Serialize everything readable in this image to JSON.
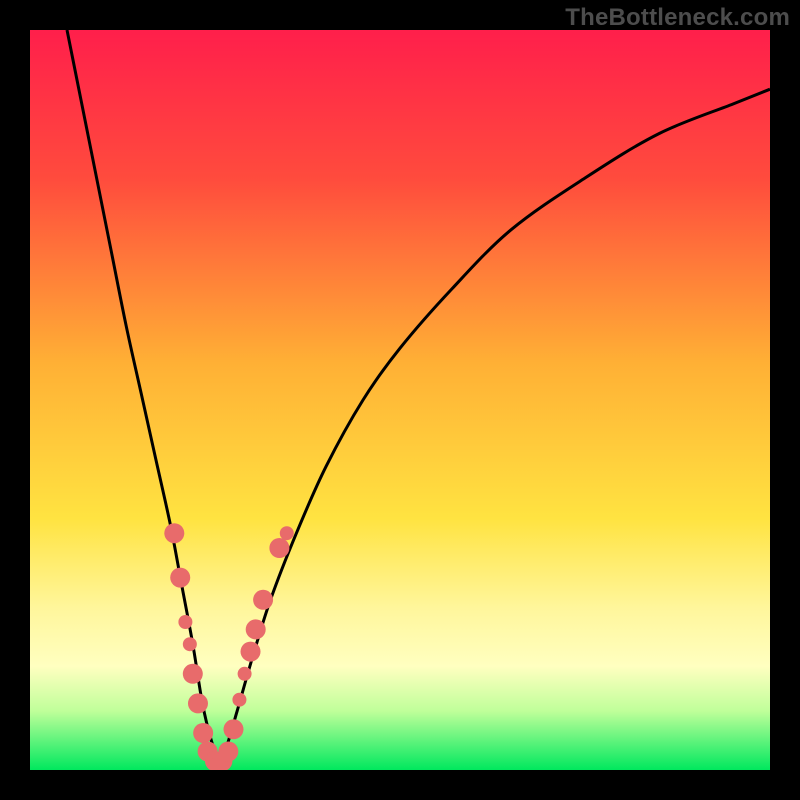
{
  "watermark": {
    "text": "TheBottleneck.com"
  },
  "gradient": {
    "stops": [
      {
        "pct": 0,
        "color": "#ff1f4b"
      },
      {
        "pct": 20,
        "color": "#ff4b3d"
      },
      {
        "pct": 45,
        "color": "#ffb035"
      },
      {
        "pct": 66,
        "color": "#ffe341"
      },
      {
        "pct": 78,
        "color": "#fff69b"
      },
      {
        "pct": 86,
        "color": "#ffffc0"
      },
      {
        "pct": 92,
        "color": "#c0ff9a"
      },
      {
        "pct": 100,
        "color": "#00e85e"
      }
    ]
  },
  "chart_data": {
    "type": "line",
    "title": "",
    "xlabel": "",
    "ylabel": "",
    "x_range": [
      0,
      100
    ],
    "y_range": [
      0,
      100
    ],
    "series": [
      {
        "name": "bottleneck-curve",
        "color": "#000000",
        "x": [
          5,
          7,
          9,
          11,
          13,
          15,
          17,
          19,
          20.5,
          22,
          23.3,
          24.5,
          25.5,
          26.5,
          28,
          30,
          32.5,
          36,
          40,
          45,
          50,
          57,
          65,
          75,
          85,
          95,
          100
        ],
        "y": [
          100,
          90,
          80,
          70,
          60,
          51,
          42,
          33,
          25,
          17,
          9,
          4,
          1.5,
          3,
          8,
          15,
          23,
          32,
          41,
          50,
          57,
          65,
          73,
          80,
          86,
          90,
          92
        ]
      }
    ],
    "markers": {
      "name": "data-points",
      "color": "#e86b6b",
      "radius_primary": 10,
      "radius_secondary": 7,
      "points": [
        {
          "x": 19.5,
          "y": 32,
          "r": "primary"
        },
        {
          "x": 20.3,
          "y": 26,
          "r": "primary"
        },
        {
          "x": 21.0,
          "y": 20,
          "r": "secondary"
        },
        {
          "x": 21.6,
          "y": 17,
          "r": "secondary"
        },
        {
          "x": 22.0,
          "y": 13,
          "r": "primary"
        },
        {
          "x": 22.7,
          "y": 9,
          "r": "primary"
        },
        {
          "x": 23.4,
          "y": 5,
          "r": "primary"
        },
        {
          "x": 24.0,
          "y": 2.5,
          "r": "primary"
        },
        {
          "x": 25.0,
          "y": 1.2,
          "r": "primary"
        },
        {
          "x": 26.0,
          "y": 1.2,
          "r": "primary"
        },
        {
          "x": 26.8,
          "y": 2.5,
          "r": "primary"
        },
        {
          "x": 27.5,
          "y": 5.5,
          "r": "primary"
        },
        {
          "x": 28.3,
          "y": 9.5,
          "r": "secondary"
        },
        {
          "x": 29.0,
          "y": 13,
          "r": "secondary"
        },
        {
          "x": 29.8,
          "y": 16,
          "r": "primary"
        },
        {
          "x": 30.5,
          "y": 19,
          "r": "primary"
        },
        {
          "x": 31.5,
          "y": 23,
          "r": "primary"
        },
        {
          "x": 33.7,
          "y": 30,
          "r": "primary"
        },
        {
          "x": 34.7,
          "y": 32,
          "r": "secondary"
        }
      ]
    }
  }
}
